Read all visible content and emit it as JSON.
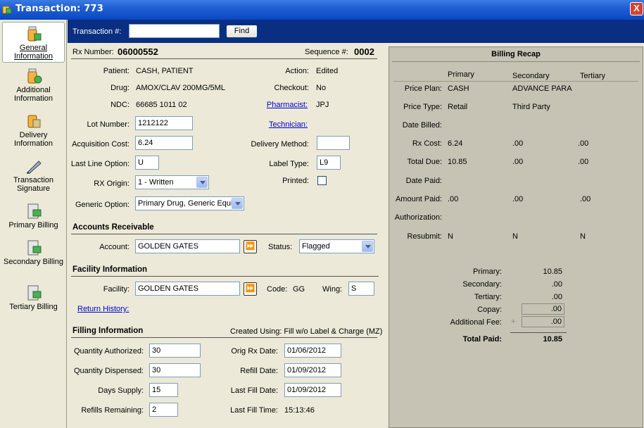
{
  "window": {
    "title": "Transaction: 773",
    "close_label": "X"
  },
  "sidebar": {
    "items": [
      {
        "label": "General Information",
        "active": true
      },
      {
        "label": "Additional Information"
      },
      {
        "label": "Delivery Information"
      },
      {
        "label": "Transaction Signature"
      },
      {
        "label": "Primary Billing"
      },
      {
        "label": "Secondary Billing"
      },
      {
        "label": "Tertiary Billing"
      }
    ]
  },
  "search": {
    "label": "Transaction #:",
    "value": "",
    "find_label": "Find"
  },
  "header": {
    "rx_label": "Rx Number:",
    "rx_value": "06000552",
    "seq_label": "Sequence #:",
    "seq_value": "0002"
  },
  "details": {
    "patient_label": "Patient:",
    "patient_value": "CASH, PATIENT",
    "drug_label": "Drug:",
    "drug_value": "AMOX/CLAV 200MG/5ML",
    "ndc_label": "NDC:",
    "ndc_value": "66685 1011 02",
    "lot_label": "Lot Number:",
    "lot_value": "1212122",
    "acq_label": "Acquisition Cost:",
    "acq_value": "6.24",
    "lastline_label": "Last Line Option:",
    "lastline_value": "U",
    "origin_label": "RX Origin:",
    "origin_value": "1 - Written",
    "generic_label": "Generic Option:",
    "generic_value": "Primary Drug, Generic Equiv",
    "action_label": "Action:",
    "action_value": "Edited",
    "checkout_label": "Checkout:",
    "checkout_value": "No",
    "pharmacist_label": "Pharmacist:",
    "pharmacist_value": "JPJ",
    "technician_label": "Technician:",
    "delivery_label": "Delivery Method:",
    "delivery_value": "",
    "labeltype_label": "Label Type:",
    "labeltype_value": "L9",
    "printed_label": "Printed:"
  },
  "ar": {
    "title": "Accounts Receivable",
    "account_label": "Account:",
    "account_value": "GOLDEN GATES",
    "status_label": "Status:",
    "status_value": "Flagged"
  },
  "facility": {
    "title": "Facility Information",
    "facility_label": "Facility:",
    "facility_value": "GOLDEN GATES",
    "code_label": "Code:",
    "code_value": "GG",
    "wing_label": "Wing:",
    "wing_value": "S",
    "return_history": "Return History:"
  },
  "filling": {
    "title": "Filling Information",
    "created_using": "Created Using: Fill w/o Label & Charge (MZ)",
    "qty_auth_label": "Quantity Authorized:",
    "qty_auth_value": "30",
    "qty_disp_label": "Quantity Dispensed:",
    "qty_disp_value": "30",
    "days_label": "Days Supply:",
    "days_value": "15",
    "refills_label": "Refills Remaining:",
    "refills_value": "2",
    "orig_label": "Orig Rx Date:",
    "orig_value": "01/06/2012",
    "refill_label": "Refill Date:",
    "refill_value": "01/09/2012",
    "lastfill_label": "Last Fill Date:",
    "lastfill_value": "01/09/2012",
    "lastfilltime_label": "Last Fill Time:",
    "lastfilltime_value": "15:13:46"
  },
  "recap": {
    "title": "Billing Recap",
    "col_primary": "Primary",
    "col_secondary": "Secondary",
    "col_tertiary": "Tertiary",
    "rows": [
      {
        "label": "Price Plan:",
        "p": "CASH",
        "s": "ADVANCE PARA",
        "t": ""
      },
      {
        "label": "Price Type:",
        "p": "Retail",
        "s": "Third Party",
        "t": ""
      },
      {
        "label": "Date Billed:",
        "p": "",
        "s": "",
        "t": ""
      },
      {
        "label": "Rx Cost:",
        "p": "6.24",
        "s": ".00",
        "t": ".00"
      },
      {
        "label": "Total Due:",
        "p": "10.85",
        "s": ".00",
        "t": ".00"
      },
      {
        "label": "Date Paid:",
        "p": "",
        "s": "",
        "t": ""
      },
      {
        "label": "Amount Paid:",
        "p": ".00",
        "s": ".00",
        "t": ".00"
      },
      {
        "label": "Authorization:",
        "p": "",
        "s": "",
        "t": ""
      },
      {
        "label": "Resubmit:",
        "p": "N",
        "s": "N",
        "t": "N"
      }
    ],
    "summary": [
      {
        "label": "Primary:",
        "value": "10.85"
      },
      {
        "label": "Secondary:",
        "value": ".00"
      },
      {
        "label": "Tertiary:",
        "value": ".00"
      },
      {
        "label": "Copay:",
        "value": ".00"
      },
      {
        "label": "Additional Fee:",
        "value": ".00"
      }
    ],
    "total_label": "Total Paid:",
    "total_value": "10.85"
  }
}
